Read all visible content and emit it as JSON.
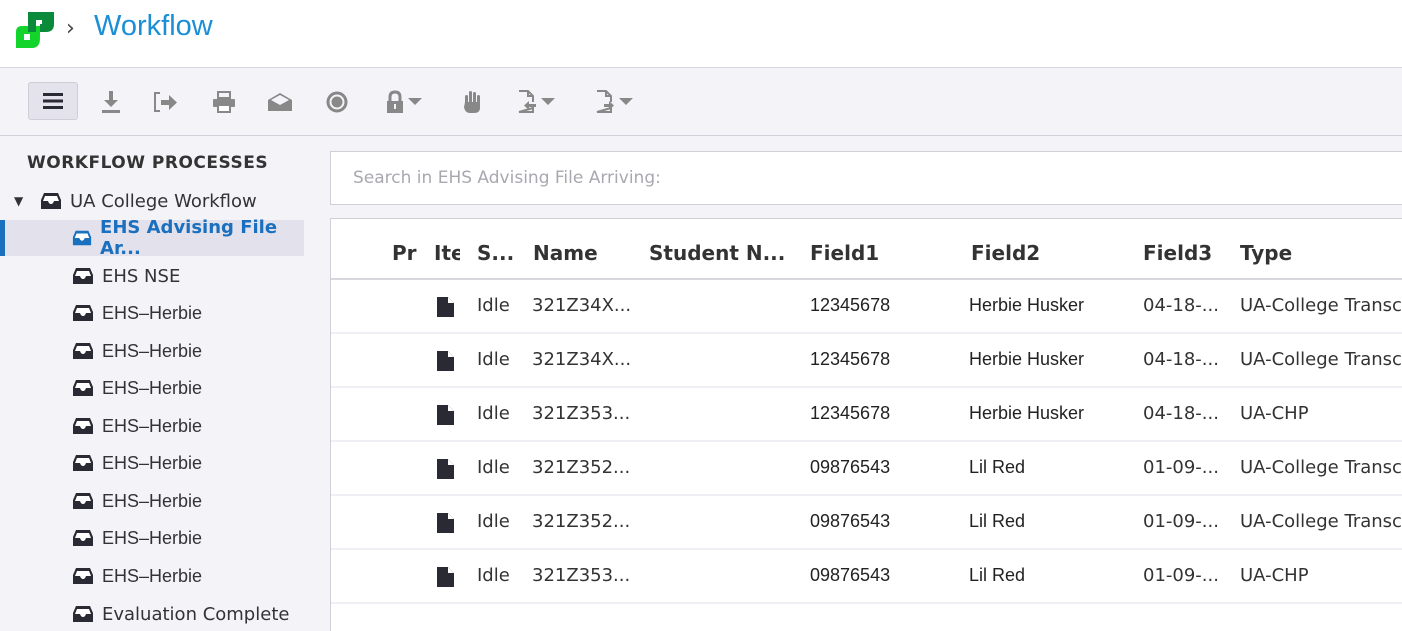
{
  "header": {
    "logo_icon": "app-logo",
    "breadcrumb_separator": "›",
    "title": "Workflow",
    "colors": {
      "title": "#1a8fd6",
      "logo_light": "#12d42a",
      "logo_dark": "#0a8a3a"
    }
  },
  "toolbar": {
    "buttons": [
      {
        "name": "menu",
        "icon": "hamburger-icon"
      },
      {
        "name": "download",
        "icon": "download-icon"
      },
      {
        "name": "export",
        "icon": "sign-out-icon"
      },
      {
        "name": "print",
        "icon": "print-icon"
      },
      {
        "name": "email",
        "icon": "envelope-open-icon"
      },
      {
        "name": "record",
        "icon": "circle-dot-icon"
      },
      {
        "name": "lock",
        "icon": "lock-icon",
        "dropdown": true
      },
      {
        "name": "hold",
        "icon": "hand-icon"
      },
      {
        "name": "document-import",
        "icon": "document-in-icon",
        "dropdown": true
      },
      {
        "name": "document-export",
        "icon": "document-out-icon",
        "dropdown": true
      }
    ]
  },
  "sidebar": {
    "title": "WORKFLOW PROCESSES",
    "root": {
      "label": "UA College Workflow",
      "expanded": true
    },
    "items": [
      {
        "label": "EHS Advising File Ar...",
        "active": true
      },
      {
        "label": "EHS NSE"
      },
      {
        "label": "EHS–Herbie"
      },
      {
        "label": "EHS–Herbie"
      },
      {
        "label": "EHS–Herbie"
      },
      {
        "label": "EHS–Herbie"
      },
      {
        "label": "EHS–Herbie"
      },
      {
        "label": "EHS–Herbie"
      },
      {
        "label": "EHS–Herbie"
      },
      {
        "label": "EHS–Herbie"
      },
      {
        "label": "Evaluation Complete"
      }
    ],
    "colors": {
      "active_text": "#1a6fbf",
      "active_bg": "#e3e2ec"
    }
  },
  "search": {
    "placeholder": "Search in EHS Advising File Arriving:",
    "value": ""
  },
  "grid": {
    "columns": [
      "Pr",
      "Ite",
      "S...",
      "Name",
      "Student N...",
      "Field1",
      "Field2",
      "Field3",
      "Type"
    ],
    "rows": [
      {
        "priority": "",
        "item_icon": "file-icon",
        "status": "Idle",
        "name": "321Z34X...",
        "student_name": "",
        "field1": "12345678",
        "field2": "Herbie Husker",
        "field3": "04-18-...",
        "type": "UA-College Transcr"
      },
      {
        "priority": "",
        "item_icon": "file-icon",
        "status": "Idle",
        "name": "321Z34X...",
        "student_name": "",
        "field1": "12345678",
        "field2": "Herbie Husker",
        "field3": "04-18-...",
        "type": "UA-College Transcr"
      },
      {
        "priority": "",
        "item_icon": "file-icon",
        "status": "Idle",
        "name": "321Z353...",
        "student_name": "",
        "field1": "12345678",
        "field2": "Herbie Husker",
        "field3": "04-18-...",
        "type": "UA-CHP"
      },
      {
        "priority": "",
        "item_icon": "file-icon",
        "status": "Idle",
        "name": "321Z352...",
        "student_name": "",
        "field1": "09876543",
        "field2": "Lil Red",
        "field3": "01-09-...",
        "type": "UA-College Transcr"
      },
      {
        "priority": "",
        "item_icon": "file-icon",
        "status": "Idle",
        "name": "321Z352...",
        "student_name": "",
        "field1": "09876543",
        "field2": "Lil Red",
        "field3": "01-09-...",
        "type": "UA-College Transcr"
      },
      {
        "priority": "",
        "item_icon": "file-icon",
        "status": "Idle",
        "name": "321Z353...",
        "student_name": "",
        "field1": "09876543",
        "field2": "Lil Red",
        "field3": "01-09-...",
        "type": "UA-CHP"
      }
    ]
  }
}
